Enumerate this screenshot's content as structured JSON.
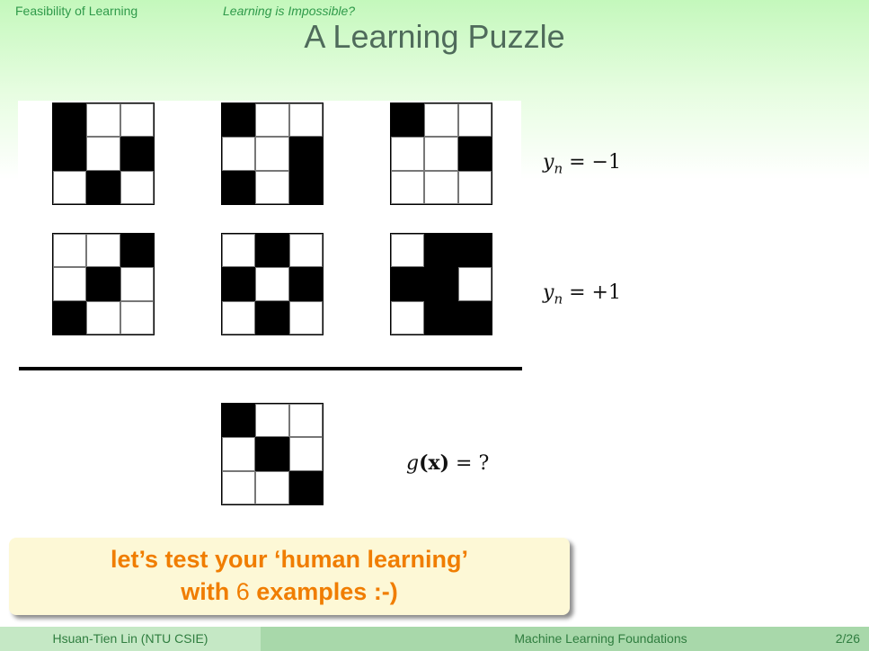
{
  "header": {
    "section": "Feasibility of Learning",
    "subsection": "Learning is Impossible?",
    "title": "A Learning Puzzle"
  },
  "puzzle": {
    "training_rows": [
      {
        "label_var": "y",
        "label_sub": "n",
        "label_value": "= −1",
        "grids": [
          [
            [
              1,
              0,
              0
            ],
            [
              1,
              0,
              1
            ],
            [
              0,
              1,
              0
            ]
          ],
          [
            [
              1,
              0,
              0
            ],
            [
              0,
              0,
              1
            ],
            [
              1,
              0,
              1
            ]
          ],
          [
            [
              1,
              0,
              0
            ],
            [
              0,
              0,
              1
            ],
            [
              0,
              0,
              0
            ]
          ]
        ]
      },
      {
        "label_var": "y",
        "label_sub": "n",
        "label_value": "= +1",
        "grids": [
          [
            [
              0,
              0,
              1
            ],
            [
              0,
              1,
              0
            ],
            [
              1,
              0,
              0
            ]
          ],
          [
            [
              0,
              1,
              0
            ],
            [
              1,
              0,
              1
            ],
            [
              0,
              1,
              0
            ]
          ],
          [
            [
              0,
              1,
              1
            ],
            [
              1,
              1,
              0
            ],
            [
              0,
              1,
              1
            ]
          ]
        ]
      }
    ],
    "test": {
      "grid": [
        [
          1,
          0,
          0
        ],
        [
          0,
          1,
          0
        ],
        [
          0,
          0,
          1
        ]
      ],
      "label_func": "g",
      "label_arg": "(x)",
      "label_value": "= ?"
    }
  },
  "callout": {
    "line1": "let’s test your ‘human learning’",
    "line2_pre": "with ",
    "line2_num": "6",
    "line2_post": " examples :-)"
  },
  "footer": {
    "author": "Hsuan-Tien Lin  (NTU CSIE)",
    "course": "Machine Learning Foundations",
    "page": "2/26"
  },
  "colors": {
    "header_text": "#2f9a4a",
    "title_text": "#4f6b5b",
    "callout_text": "#f07d00",
    "callout_bg": "#fdf8d6",
    "footer_left_bg": "#c5e8c5",
    "footer_right_bg": "#a8d8aa"
  }
}
